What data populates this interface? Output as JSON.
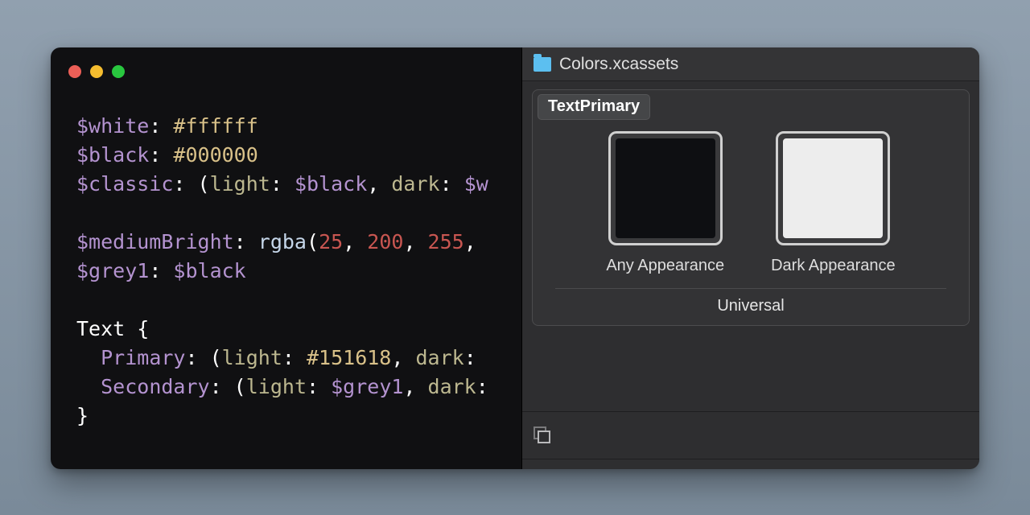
{
  "editor": {
    "line1_var": "$white",
    "line1_val": "#ffffff",
    "line2_var": "$black",
    "line2_val": "#000000",
    "line3_var": "$classic",
    "line3_light_key": "light",
    "line3_light_val": "$black",
    "line3_dark_key": "dark",
    "line3_dark_val": "$w",
    "line4_var": "$mediumBright",
    "line4_func": "rgba",
    "line4_a": "25",
    "line4_b": "200",
    "line4_c": "255",
    "line5_var": "$grey1",
    "line5_val": "$black",
    "block_name": "Text",
    "primary_key": "Primary",
    "primary_light_key": "light",
    "primary_light_val": "#151618",
    "primary_dark_key": "dark",
    "secondary_key": "Secondary",
    "secondary_light_key": "light",
    "secondary_light_val": "$grey1",
    "secondary_dark_key": "dark"
  },
  "panel": {
    "header_title": "Colors.xcassets",
    "asset_name": "TextPrimary",
    "swatches": [
      {
        "label": "Any Appearance",
        "color": "#0e0f12"
      },
      {
        "label": "Dark Appearance",
        "color": "#ededed"
      }
    ],
    "universal_label": "Universal"
  }
}
